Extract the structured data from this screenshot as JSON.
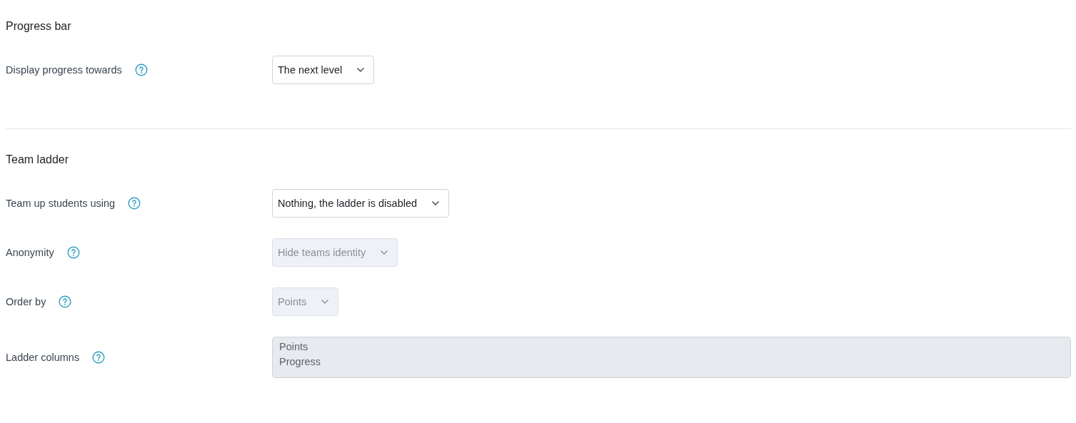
{
  "sections": [
    {
      "heading": "Progress bar",
      "fields": [
        {
          "kind": "select",
          "label": "Display progress towards",
          "value": "The next level",
          "disabled": false
        }
      ]
    },
    {
      "heading": "Team ladder",
      "fields": [
        {
          "kind": "select",
          "label": "Team up students using",
          "value": "Nothing, the ladder is disabled",
          "disabled": false
        },
        {
          "kind": "select",
          "label": "Anonymity",
          "value": "Hide teams identity",
          "disabled": true
        },
        {
          "kind": "select",
          "label": "Order by",
          "value": "Points",
          "disabled": true
        },
        {
          "kind": "multiselect",
          "label": "Ladder columns",
          "options": [
            "Points",
            "Progress"
          ],
          "disabled": true
        }
      ]
    }
  ]
}
